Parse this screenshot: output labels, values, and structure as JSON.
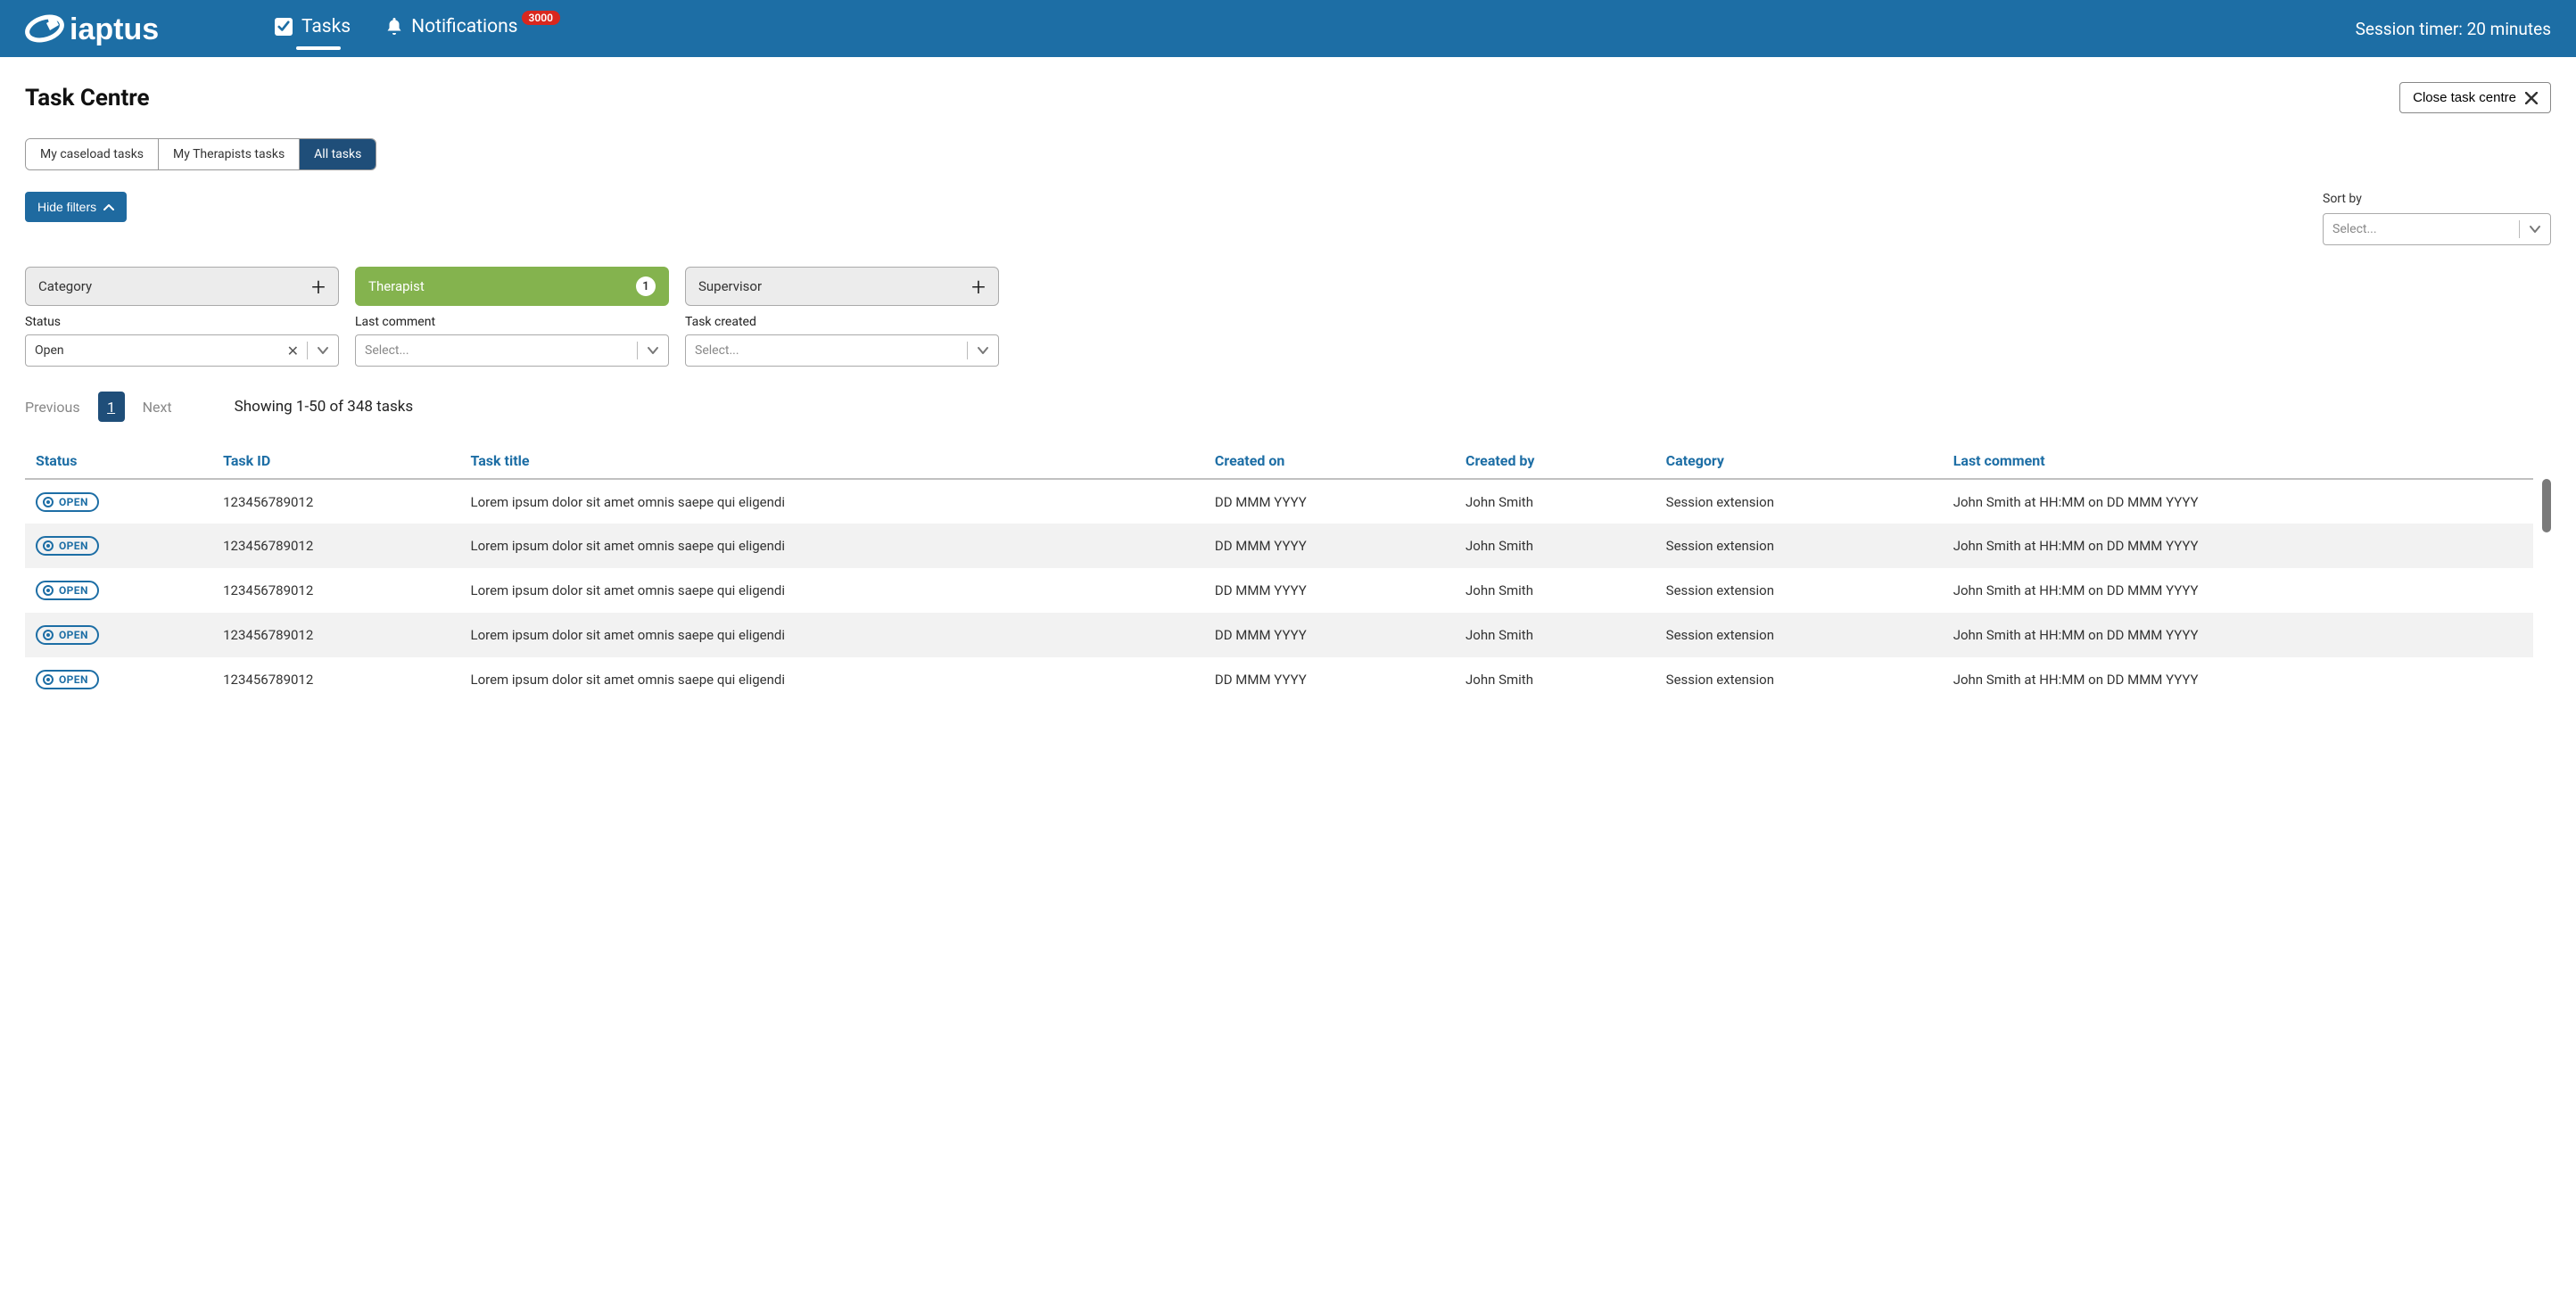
{
  "header": {
    "brand": "iaptus",
    "nav": {
      "tasks_label": "Tasks",
      "notifications_label": "Notifications",
      "notifications_badge": "3000"
    },
    "session_timer": "Session timer: 20 minutes"
  },
  "page": {
    "title": "Task Centre",
    "close_button": "Close task centre"
  },
  "view_tabs": {
    "my_caseload": "My caseload tasks",
    "my_therapists": "My Therapists tasks",
    "all_tasks": "All tasks"
  },
  "filters": {
    "hide_filters": "Hide filters",
    "sort_by_label": "Sort by",
    "sort_by_placeholder": "Select...",
    "cards": {
      "category": {
        "label": "Category"
      },
      "therapist": {
        "label": "Therapist",
        "count": "1"
      },
      "supervisor": {
        "label": "Supervisor"
      }
    },
    "selects": {
      "status": {
        "label": "Status",
        "value": "Open"
      },
      "last_comment": {
        "label": "Last comment",
        "placeholder": "Select..."
      },
      "task_created": {
        "label": "Task created",
        "placeholder": "Select..."
      }
    }
  },
  "pagination": {
    "previous": "Previous",
    "page": "1",
    "next": "Next",
    "showing": "Showing 1-50 of 348 tasks"
  },
  "table": {
    "headers": {
      "status": "Status",
      "task_id": "Task ID",
      "task_title": "Task title",
      "created_on": "Created on",
      "created_by": "Created by",
      "category": "Category",
      "last_comment": "Last comment"
    },
    "rows": [
      {
        "status": "OPEN",
        "task_id": "123456789012",
        "task_title": "Lorem ipsum dolor sit amet omnis saepe qui eligendi",
        "created_on": "DD MMM YYYY",
        "created_by": "John Smith",
        "category": "Session extension",
        "last_comment": "John Smith at HH:MM on DD MMM YYYY"
      },
      {
        "status": "OPEN",
        "task_id": "123456789012",
        "task_title": "Lorem ipsum dolor sit amet omnis saepe qui eligendi",
        "created_on": "DD MMM YYYY",
        "created_by": "John Smith",
        "category": "Session extension",
        "last_comment": "John Smith at HH:MM on DD MMM YYYY"
      },
      {
        "status": "OPEN",
        "task_id": "123456789012",
        "task_title": "Lorem ipsum dolor sit amet omnis saepe qui eligendi",
        "created_on": "DD MMM YYYY",
        "created_by": "John Smith",
        "category": "Session extension",
        "last_comment": "John Smith at HH:MM on DD MMM YYYY"
      },
      {
        "status": "OPEN",
        "task_id": "123456789012",
        "task_title": "Lorem ipsum dolor sit amet omnis saepe qui eligendi",
        "created_on": "DD MMM YYYY",
        "created_by": "John Smith",
        "category": "Session extension",
        "last_comment": "John Smith at HH:MM on DD MMM YYYY"
      },
      {
        "status": "OPEN",
        "task_id": "123456789012",
        "task_title": "Lorem ipsum dolor sit amet omnis saepe qui eligendi",
        "created_on": "DD MMM YYYY",
        "created_by": "John Smith",
        "category": "Session extension",
        "last_comment": "John Smith at HH:MM on DD MMM YYYY"
      }
    ]
  }
}
